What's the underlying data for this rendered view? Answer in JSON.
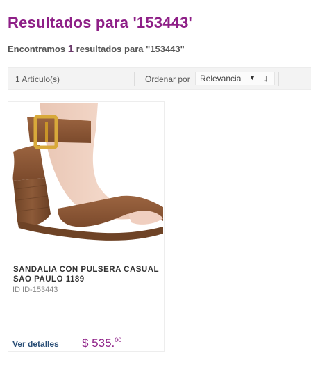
{
  "header": {
    "title": "Resultados para '153443'",
    "summary_prefix": "Encontramos",
    "summary_count": "1",
    "summary_suffix": "resultados para \"153443\""
  },
  "toolbar": {
    "article_count": "1 Artículo(s)",
    "sort_label": "Ordenar por",
    "sort_selected": "Relevancia",
    "sort_options": [
      "Relevancia"
    ],
    "sort_direction_icon": "arrow-down-icon"
  },
  "products": [
    {
      "name": "SANDALIA CON PULSERA CASUAL SAO PAULO 1189",
      "id_text": "ID ID-153443",
      "details_label": "Ver detalles",
      "price_main": "$ 535.",
      "price_cents": "00",
      "image_icon": "sandal-image"
    }
  ],
  "colors": {
    "brand_purple": "#8e1f87",
    "link_blue": "#2b4f77",
    "sandal_brown": "#8a5636"
  }
}
